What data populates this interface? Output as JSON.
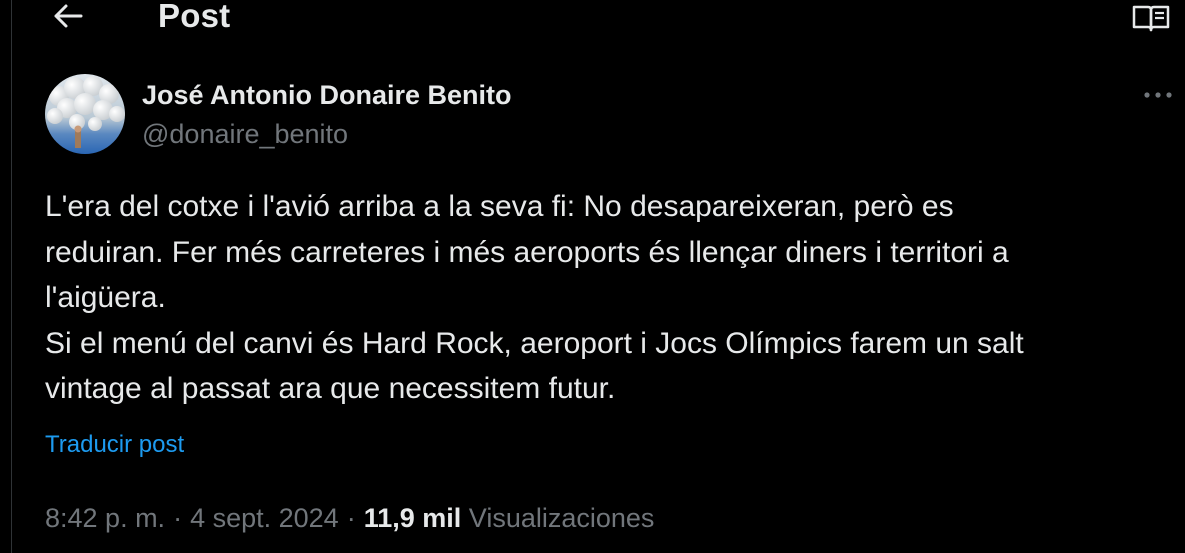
{
  "header": {
    "title": "Post",
    "back_icon": "arrow-left-icon",
    "reader_icon": "open-book-icon"
  },
  "author": {
    "name": "José Antonio Donaire Benito",
    "handle": "@donaire_benito",
    "more_icon": "more-horizontal-icon"
  },
  "post": {
    "lines": [
      "L'era del cotxe i l'avió arriba a la seva fi: No desapareixeran, però es",
      "reduiran. Fer més carreteres i més aeroports és llençar diners i territori a",
      "l'aigüera.",
      "Si el menú del canvi és Hard Rock, aeroport i Jocs Olímpics farem un salt",
      "vintage al passat ara que necessitem futur."
    ],
    "translate_label": "Traducir post"
  },
  "meta": {
    "time": "8:42 p. m.",
    "separator": "·",
    "date": "4 sept. 2024",
    "views_count": "11,9 mil",
    "views_label": "Visualizaciones"
  },
  "colors": {
    "background": "#000000",
    "text_primary": "#e7e9ea",
    "text_secondary": "#71767b",
    "link": "#1d9bf0",
    "border": "#2f3336"
  }
}
